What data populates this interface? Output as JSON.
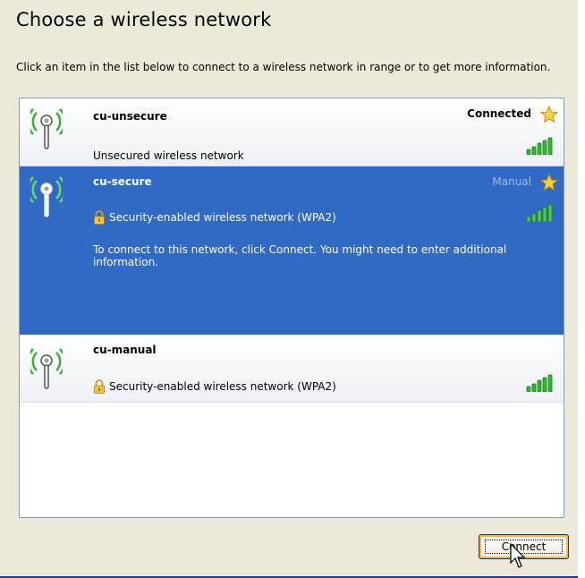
{
  "title": "Choose a wireless network",
  "instructions": "Click an item in the list below to connect to a wireless network in range or to get more information.",
  "networks": [
    {
      "name": "cu-unsecure",
      "description": "Unsecured wireless network",
      "status": "Connected",
      "secured": false,
      "selected": false,
      "icons": {
        "network": "wireless-antenna-icon",
        "star": "star-icon",
        "signal": "signal-strength-icon"
      }
    },
    {
      "name": "cu-secure",
      "description": "Security-enabled wireless network (WPA2)",
      "status": "Manual",
      "secured": true,
      "selected": true,
      "extra_info": "To connect to this network, click Connect. You might need to enter additional information.",
      "icons": {
        "network": "wireless-antenna-icon",
        "lock": "lock-icon",
        "star": "star-icon",
        "signal": "signal-strength-icon"
      }
    },
    {
      "name": "cu-manual",
      "description": "Security-enabled wireless network (WPA2)",
      "status": "",
      "secured": true,
      "selected": false,
      "icons": {
        "network": "wireless-antenna-icon",
        "lock": "lock-icon",
        "signal": "signal-strength-icon"
      }
    }
  ],
  "connect_button": {
    "label": "Connect"
  },
  "colors": {
    "selection": "#316ac5",
    "panel": "#ece9d8",
    "signal_green": "#2fb82f",
    "star_gold": "#f5c518",
    "button_border": "#003c74",
    "focus_orange": "#f8b54a"
  }
}
